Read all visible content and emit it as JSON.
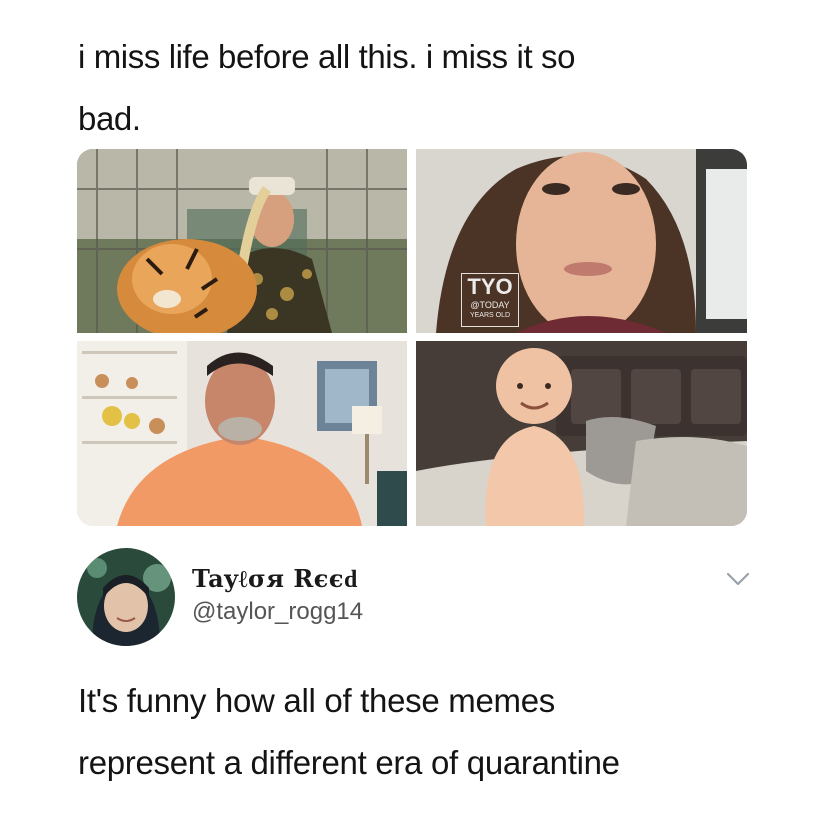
{
  "caption": {
    "line1": "i miss life before all this. i miss it so",
    "line2": "bad."
  },
  "images": {
    "top_right_watermark": {
      "logo": "TYO",
      "sub": "@TODAY",
      "sub2": "YEARS OLD"
    }
  },
  "tweet": {
    "display_name": "Tayℓσя Rєєԁ",
    "handle": "@taylor_rogg14",
    "line1": "It's funny how all of these memes",
    "line2": "represent a different era of quarantine",
    "menu_icon": "chevron-down-icon"
  }
}
